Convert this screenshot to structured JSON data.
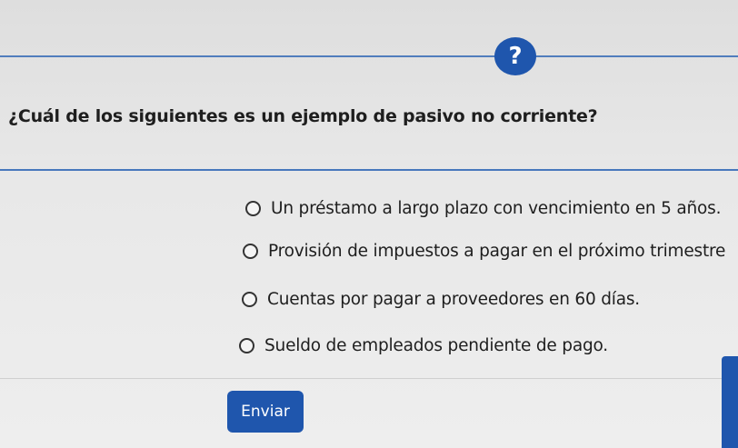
{
  "colors": {
    "accent": "#1f56ad",
    "background": "#e6e6e6",
    "text": "#1e1e1e"
  },
  "help": {
    "icon": "question-mark-icon",
    "symbol": "?"
  },
  "quiz": {
    "question": "¿Cuál de los siguientes es un ejemplo de pasivo no corriente?",
    "options": [
      {
        "label": "Un préstamo a largo plazo con vencimiento en 5 años.",
        "selected": false
      },
      {
        "label": "Provisión de impuestos a pagar en el próximo trimestre",
        "selected": false
      },
      {
        "label": "Cuentas por pagar a proveedores en 60 días.",
        "selected": false
      },
      {
        "label": "Sueldo de empleados pendiente de pago.",
        "selected": false
      }
    ],
    "submit_label": "Enviar"
  }
}
